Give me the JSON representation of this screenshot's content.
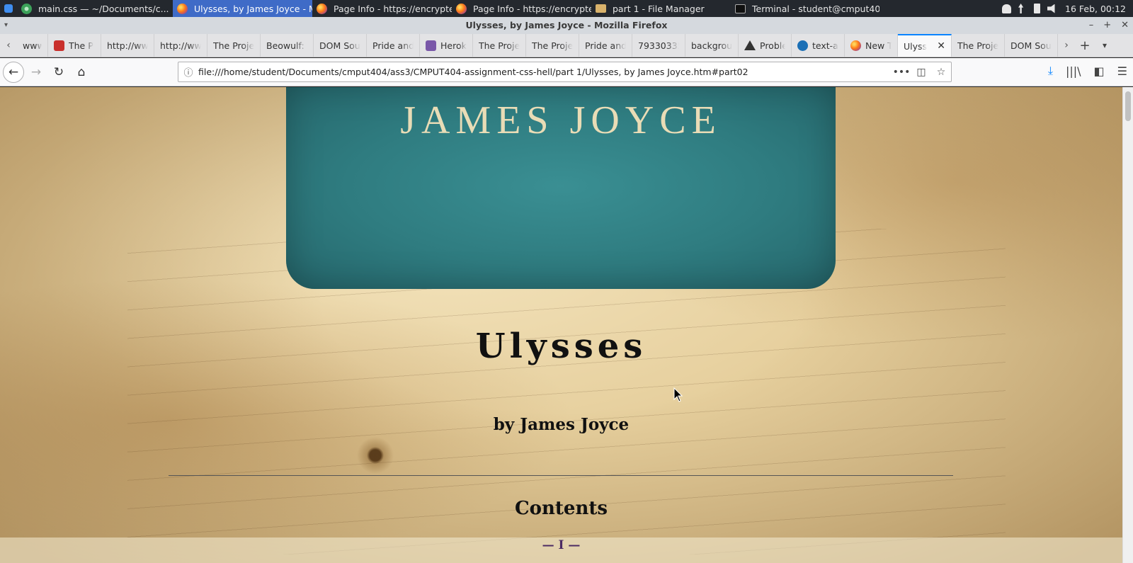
{
  "taskbar": {
    "tasks": [
      {
        "label": "main.css — ~/Documents/c...",
        "icon": "chrome-icon"
      },
      {
        "label": "Ulysses, by James Joyce - Mo...",
        "icon": "firefox-icon"
      },
      {
        "label": "Page Info - https://encrypted...",
        "icon": "firefox-icon"
      },
      {
        "label": "Page Info - https://encrypted...",
        "icon": "firefox-icon"
      },
      {
        "label": "part 1 - File Manager",
        "icon": "folder-icon"
      },
      {
        "label": "Terminal - student@cmput40...",
        "icon": "terminal-icon"
      }
    ],
    "clock": "16 Feb, 00:12"
  },
  "window": {
    "title": "Ulysses, by James Joyce - Mozilla Firefox"
  },
  "tabs": [
    {
      "label": "www"
    },
    {
      "label": "The P",
      "favicon": "red"
    },
    {
      "label": "http://ww"
    },
    {
      "label": "http://ww"
    },
    {
      "label": "The Proje"
    },
    {
      "label": "Beowulf: A"
    },
    {
      "label": "DOM Sou"
    },
    {
      "label": "Pride and"
    },
    {
      "label": "Herok",
      "favicon": "purple"
    },
    {
      "label": "The Proje"
    },
    {
      "label": "The Proje"
    },
    {
      "label": "Pride and"
    },
    {
      "label": "79330335"
    },
    {
      "label": "backgrou"
    },
    {
      "label": "Proble",
      "favicon": "warn"
    },
    {
      "label": "text-a",
      "favicon": "mdn"
    },
    {
      "label": "New T",
      "favicon": "ff"
    },
    {
      "label": "Ulyss",
      "active": true
    },
    {
      "label": "The Proje"
    },
    {
      "label": "DOM Sou"
    }
  ],
  "navbar": {
    "url": "file:///home/student/Documents/cmput404/ass3/CMPUT404-assignment-css-hell/part 1/Ulysses, by James Joyce.htm#part02"
  },
  "page": {
    "cover_author": "JAMES JOYCE",
    "title": "Ulysses",
    "byline": "by James Joyce",
    "contents_heading": "Contents",
    "part_link": "— I —"
  },
  "colors": {
    "cover_teal": "#2f7c80",
    "parchment": "#e6cf9d",
    "tab_accent": "#0a84ff",
    "taskbar_active": "#3f6bc7"
  }
}
